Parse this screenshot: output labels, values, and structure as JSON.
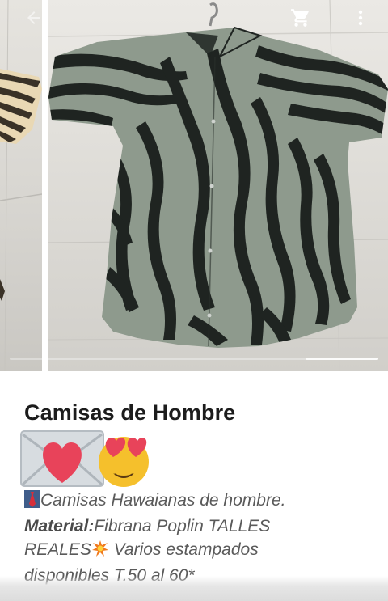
{
  "toolbar": {
    "back_icon": "arrow-left-icon",
    "cart_icon": "shopping-cart-icon",
    "menu_icon": "more-vertical-icon"
  },
  "gallery": {
    "previous_photo": "zebra-print-fabric-photo",
    "current_photo": "zebra-print-shirt-photo"
  },
  "product": {
    "title": "Camisas de Hombre",
    "emojis": [
      "love-letter-emoji",
      "heart-eyes-emoji"
    ],
    "description": {
      "line1_text": "Camisas Hawaianas de hombre.",
      "material_label": "Material:",
      "material_text": "Fibrana Poplin TALLES",
      "line3_text": "REALES",
      "line3_rest": " Varios estampados",
      "line4_text": "disponibles T.50 al 60*"
    }
  },
  "colors": {
    "shirt_base": "#8e9a8d",
    "stripe": "#1f2421",
    "heart": "#e8435a",
    "emoji_face": "#f5c02c"
  }
}
